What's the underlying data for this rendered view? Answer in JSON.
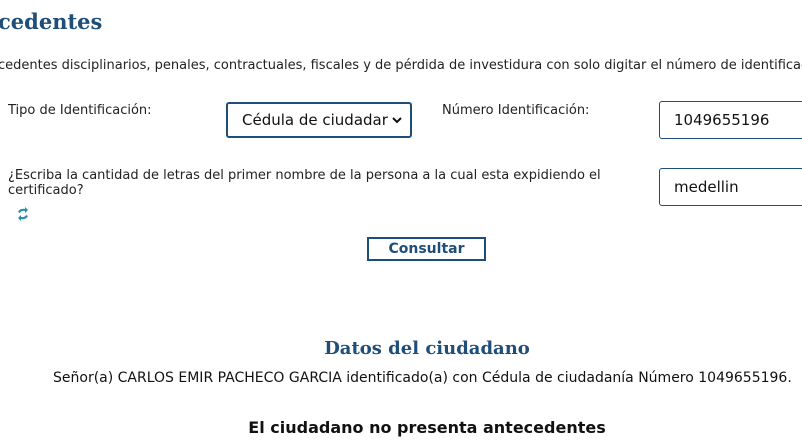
{
  "page": {
    "title": "cedentes",
    "intro": "cedentes disciplinarios, penales, contractuales, fiscales y de pérdida de investidura con solo digitar el número de identificación"
  },
  "form": {
    "id_type_label": "Tipo de Identificación:",
    "id_type_value": "Cédula de ciudadar",
    "id_number_label": "Número Identificación:",
    "id_number_value": "1049655196",
    "question_label": "¿Escriba la cantidad de letras del primer nombre de la persona a la cual esta expidiendo el certificado?",
    "answer_value": "medellin",
    "refresh_icon": "refresh-icon",
    "dropdown_icon": "chevron-down-icon",
    "submit_label": "Consultar"
  },
  "result": {
    "section_title": "Datos del ciudadano",
    "citizen_line": "Señor(a)  CARLOS EMIR PACHECO GARCIA identificado(a) con Cédula de ciudadanía Número 1049655196.",
    "status": "El ciudadano no presenta antecedentes"
  },
  "colors": {
    "accent": "#1f4e79",
    "refresh_icon": "#2a8fa3"
  }
}
